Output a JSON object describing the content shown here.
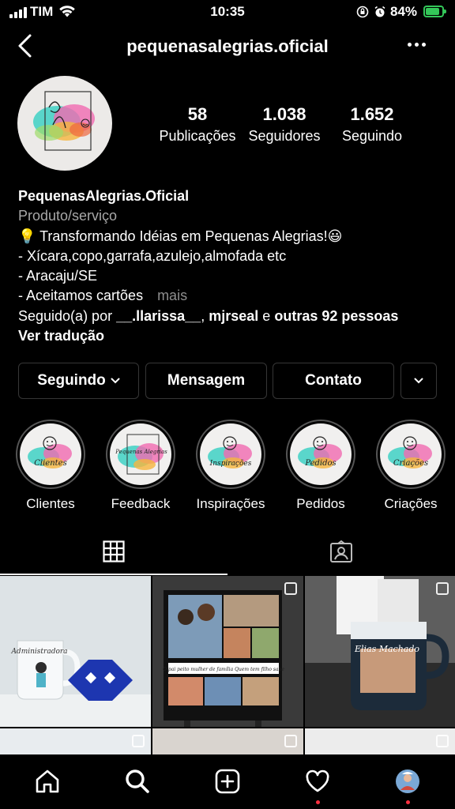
{
  "status_bar": {
    "carrier": "TIM",
    "time": "10:35",
    "battery": "84%",
    "battery_level": 0.84
  },
  "header": {
    "username": "pequenasalegrias.oficial"
  },
  "profile": {
    "stats": [
      {
        "value": "58",
        "label": "Publicações"
      },
      {
        "value": "1.038",
        "label": "Seguidores"
      },
      {
        "value": "1.652",
        "label": "Seguindo"
      }
    ],
    "name": "PequenasAlegrias.Oficial",
    "category": "Produto/serviço",
    "bio_lines": [
      "💡 Transformando Idéias em Pequenas Alegrias!😃",
      "- Xícara,copo,garrafa,azulejo,almofada etc",
      "- Aracaju/SE",
      "- Aceitamos cartões"
    ],
    "more": "mais",
    "followed_by": {
      "prefix": "Seguido(a) por",
      "user1": "__.llarissa__",
      "sep": ",",
      "user2": "mjrseal",
      "and": "e",
      "others": "outras 92 pessoas"
    },
    "translate": "Ver tradução"
  },
  "actions": {
    "following": "Seguindo",
    "message": "Mensagem",
    "contact": "Contato"
  },
  "highlights": [
    {
      "label": "Clientes",
      "cover_text": "Clientes"
    },
    {
      "label": "Feedback",
      "cover_text": "Pequenas Alegrias"
    },
    {
      "label": "Inspirações",
      "cover_text": "Inspirações"
    },
    {
      "label": "Pedidos",
      "cover_text": "Pedidos"
    },
    {
      "label": "Criações",
      "cover_text": "Criações"
    }
  ],
  "posts": [
    {
      "mug_text": "Administradora"
    },
    {
      "caption": "O pai peito mulher de família Quem tem filho sabe"
    },
    {
      "mug_text": "Elias Machado"
    }
  ],
  "colors": {
    "background": "#000000",
    "border": "#363636",
    "muted": "#a8a8a8",
    "notification": "#ff3040",
    "battery": "#34c759"
  }
}
